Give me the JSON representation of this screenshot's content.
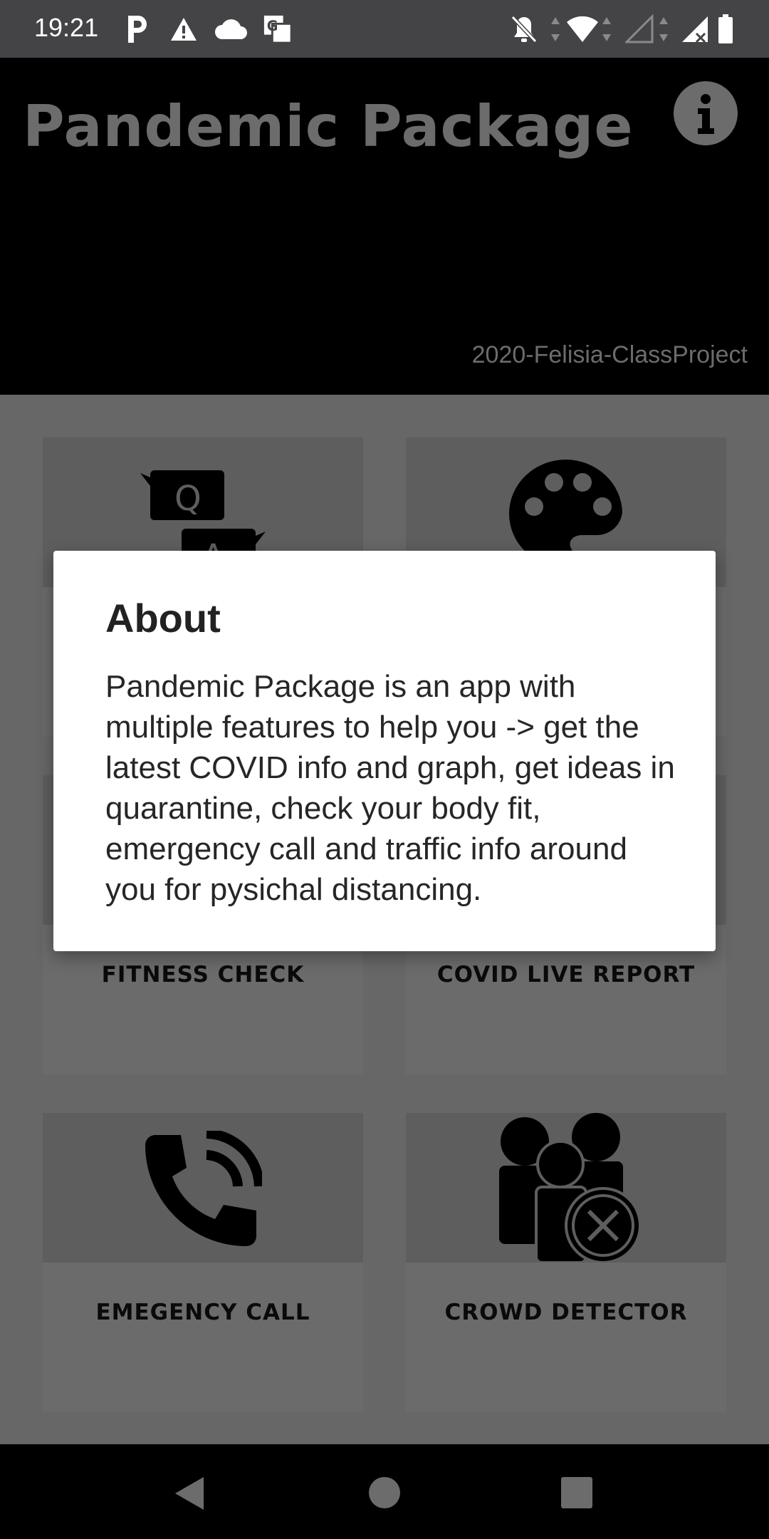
{
  "status_bar": {
    "time": "19:21",
    "icons": [
      "parking-icon",
      "warning-icon",
      "cloud-icon",
      "translate-icon",
      "notifications-off-icon",
      "wifi-icon",
      "signal-empty-icon",
      "signal-x-icon",
      "battery-icon"
    ]
  },
  "header": {
    "title": "Pandemic Package",
    "credit": "2020-Felisia-ClassProject",
    "info_icon": "info-icon"
  },
  "features": [
    {
      "label": "",
      "icon": "qa-icon"
    },
    {
      "label": "",
      "icon": "palette-icon"
    },
    {
      "label": "FITNESS CHECK",
      "icon": ""
    },
    {
      "label": "COVID LIVE REPORT",
      "icon": ""
    },
    {
      "label": "EMEGENCY CALL",
      "icon": "phone-call-icon"
    },
    {
      "label": "CROWD DETECTOR",
      "icon": "crowd-icon"
    }
  ],
  "dialog": {
    "title": "About",
    "message": "Pandemic Package is an app with multiple features to help you -> get the latest COVID info and graph, get ideas in quarantine, check your body fit, emergency call and traffic info around you for pysichal distancing."
  },
  "nav_bar": {
    "icons": [
      "back-icon",
      "home-icon",
      "recents-icon"
    ]
  }
}
